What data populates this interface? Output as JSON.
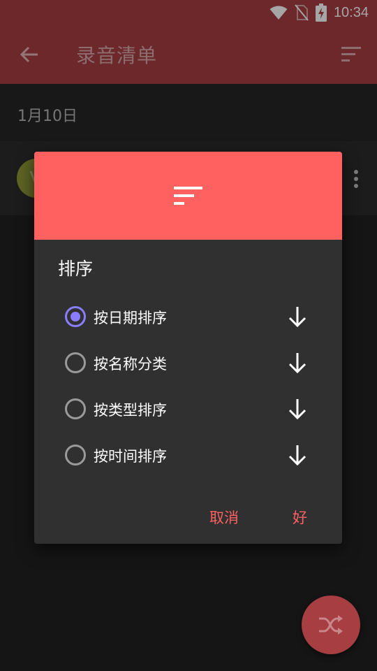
{
  "status_bar": {
    "time": "10:34"
  },
  "app_bar": {
    "title": "录音清单"
  },
  "list": {
    "date_header": "1月10日",
    "recording": {
      "avatar_letter": "V"
    }
  },
  "dialog": {
    "title": "排序",
    "options": [
      {
        "label": "按日期排序",
        "selected": true
      },
      {
        "label": "按名称分类",
        "selected": false
      },
      {
        "label": "按类型排序",
        "selected": false
      },
      {
        "label": "按时间排序",
        "selected": false
      }
    ],
    "cancel_label": "取消",
    "ok_label": "好"
  },
  "colors": {
    "app_bar": "#a63e42",
    "dialog_header": "#ff6161",
    "radio_selected": "#8a7cff",
    "action_text": "#ff6161"
  },
  "icons": [
    "wifi-icon",
    "no-sim-icon",
    "battery-charging-icon",
    "back-arrow-icon",
    "sort-icon",
    "more-vert-icon",
    "arrow-down-icon",
    "shuffle-icon"
  ]
}
